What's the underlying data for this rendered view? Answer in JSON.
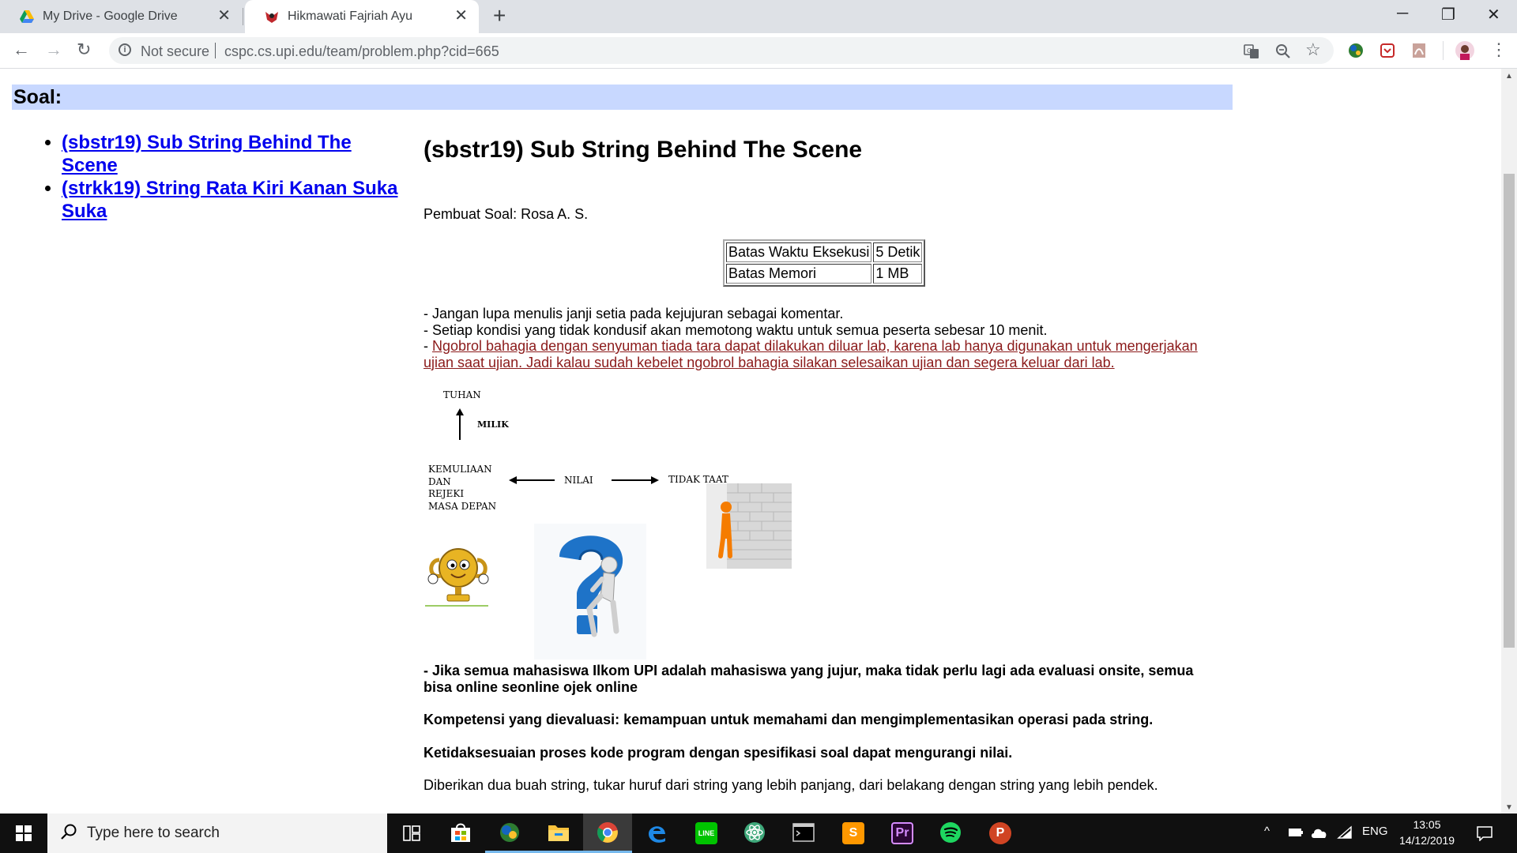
{
  "browser": {
    "tabs": [
      {
        "title": "My Drive - Google Drive",
        "close": "✕"
      },
      {
        "title": "Hikmawati Fajriah Ayu",
        "close": "✕"
      }
    ],
    "new_tab": "+",
    "window_controls": {
      "minimize": "─",
      "restore": "❐",
      "close": "✕"
    },
    "nav": {
      "back": "←",
      "forward": "→",
      "reload": "↻"
    },
    "security_label": "Not secure",
    "url": "cspc.cs.upi.edu/team/problem.php?cid=665",
    "omnibox_icons": [
      "translate-icon",
      "zoom-icon",
      "bookmark-star-icon"
    ],
    "extensions": [
      "earth-extension-icon",
      "pocket-extension-icon",
      "pdf-extension-icon"
    ],
    "menu": "⋮"
  },
  "page": {
    "header": "Soal:",
    "problem_list": [
      "(sbstr19) Sub String Behind The Scene",
      "(strkk19) String Rata Kiri Kanan Suka Suka"
    ],
    "title": "(sbstr19) Sub String Behind The Scene",
    "author": "Pembuat Soal: Rosa A. S.",
    "limits": [
      {
        "label": "Batas Waktu Eksekusi",
        "value": "5 Detik"
      },
      {
        "label": "Batas Memori",
        "value": "1 MB"
      }
    ],
    "rules": {
      "line1": "- Jangan lupa menulis janji setia pada kejujuran sebagai komentar.",
      "line2": "- Setiap kondisi yang tidak kondusif akan memotong waktu untuk semua peserta sebesar 10 menit.",
      "line3_prefix": "- ",
      "line3_link": "Ngobrol bahagia dengan senyuman tiada tara dapat dilakukan diluar lab, karena lab hanya digunakan untuk mengerjakan ujian saat ujian. Jadi kalau sudah kebelet ngobrol bahagia silakan selesaikan ujian dan segera keluar dari lab."
    },
    "diagram": {
      "top": "TUHAN",
      "milik": "MILIK",
      "left_lines": [
        "KEMULIAAN",
        "DAN",
        "REJEKI",
        "MASA DEPAN"
      ],
      "center": "NILAI",
      "right": "TIDAK TAAT"
    },
    "bold_paragraphs": [
      "- Jika semua mahasiswa Ilkom UPI adalah mahasiswa yang jujur, maka tidak perlu lagi ada evaluasi onsite, semua bisa online seonline ojek online",
      "Kompetensi yang dievaluasi: kemampuan untuk memahami dan mengimplementasikan operasi pada string.",
      "Ketidaksesuaian proses kode program dengan spesifikasi soal dapat mengurangi nilai."
    ],
    "closing": "Diberikan dua buah string, tukar huruf dari string yang lebih panjang, dari belakang dengan string yang lebih pendek."
  },
  "taskbar": {
    "search_placeholder": "Type here to search",
    "apps": [
      "task-view",
      "microsoft-store",
      "photos",
      "file-explorer",
      "chrome",
      "edge",
      "line",
      "atom",
      "terminal",
      "sublime-text",
      "premiere-pro",
      "spotify",
      "powerpoint"
    ],
    "premiere_label": "Pr",
    "line_label": "LINE",
    "powerpoint_label": "P",
    "sublime_label": "S",
    "language": "ENG",
    "time": "13:05",
    "date": "14/12/2019"
  },
  "colors": {
    "header_bg": "#c8d8ff",
    "link": "#0000ee",
    "rule_link": "#8b1a1a",
    "taskbar": "#101010"
  }
}
